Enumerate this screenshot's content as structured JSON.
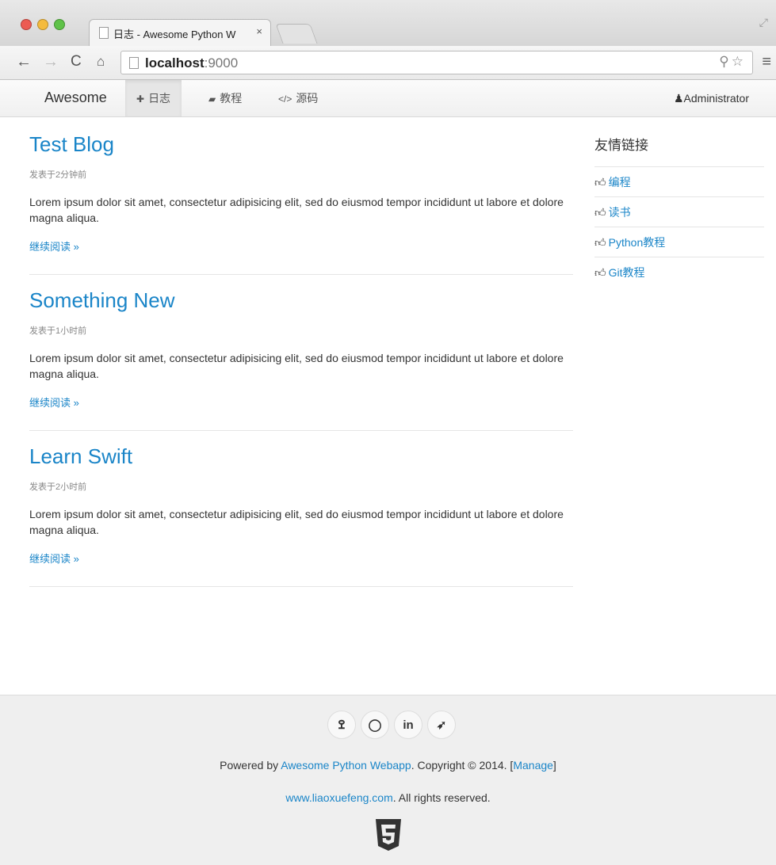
{
  "browser": {
    "tab_title": "日志 - Awesome Python W",
    "tab_close": "×",
    "url_host": "localhost",
    "url_port": ":9000"
  },
  "navbar": {
    "brand": "Awesome",
    "items": [
      {
        "icon": "home-icon",
        "label": "日志",
        "active": true
      },
      {
        "icon": "book-icon",
        "label": "教程",
        "active": false
      },
      {
        "icon": "code-icon",
        "label": "源码",
        "active": false
      }
    ],
    "user": "Administrator"
  },
  "posts": [
    {
      "title": "Test Blog",
      "date": "发表于2分钟前",
      "summary": "Lorem ipsum dolor sit amet, consectetur adipisicing elit, sed do eiusmod tempor incididunt ut labore et dolore magna aliqua.",
      "read_more": "继续阅读 »"
    },
    {
      "title": "Something New",
      "date": "发表于1小时前",
      "summary": "Lorem ipsum dolor sit amet, consectetur adipisicing elit, sed do eiusmod tempor incididunt ut labore et dolore magna aliqua.",
      "read_more": "继续阅读 »"
    },
    {
      "title": "Learn Swift",
      "date": "发表于2小时前",
      "summary": "Lorem ipsum dolor sit amet, consectetur adipisicing elit, sed do eiusmod tempor incididunt ut labore et dolore magna aliqua.",
      "read_more": "继续阅读 »"
    }
  ],
  "sidebar": {
    "title": "友情链接",
    "links": [
      "编程",
      "读书",
      "Python教程",
      "Git教程"
    ]
  },
  "footer": {
    "social": [
      "weibo-icon",
      "github-icon",
      "linkedin-icon",
      "twitter-icon"
    ],
    "powered_prefix": "Powered by ",
    "powered_link": "Awesome Python Webapp",
    "copyright": ". Copyright © 2014. [",
    "manage": "Manage",
    "bracket_close": "]",
    "site_link": "www.liaoxuefeng.com",
    "rights": ". All rights reserved."
  },
  "colors": {
    "link": "#1a85c8"
  }
}
